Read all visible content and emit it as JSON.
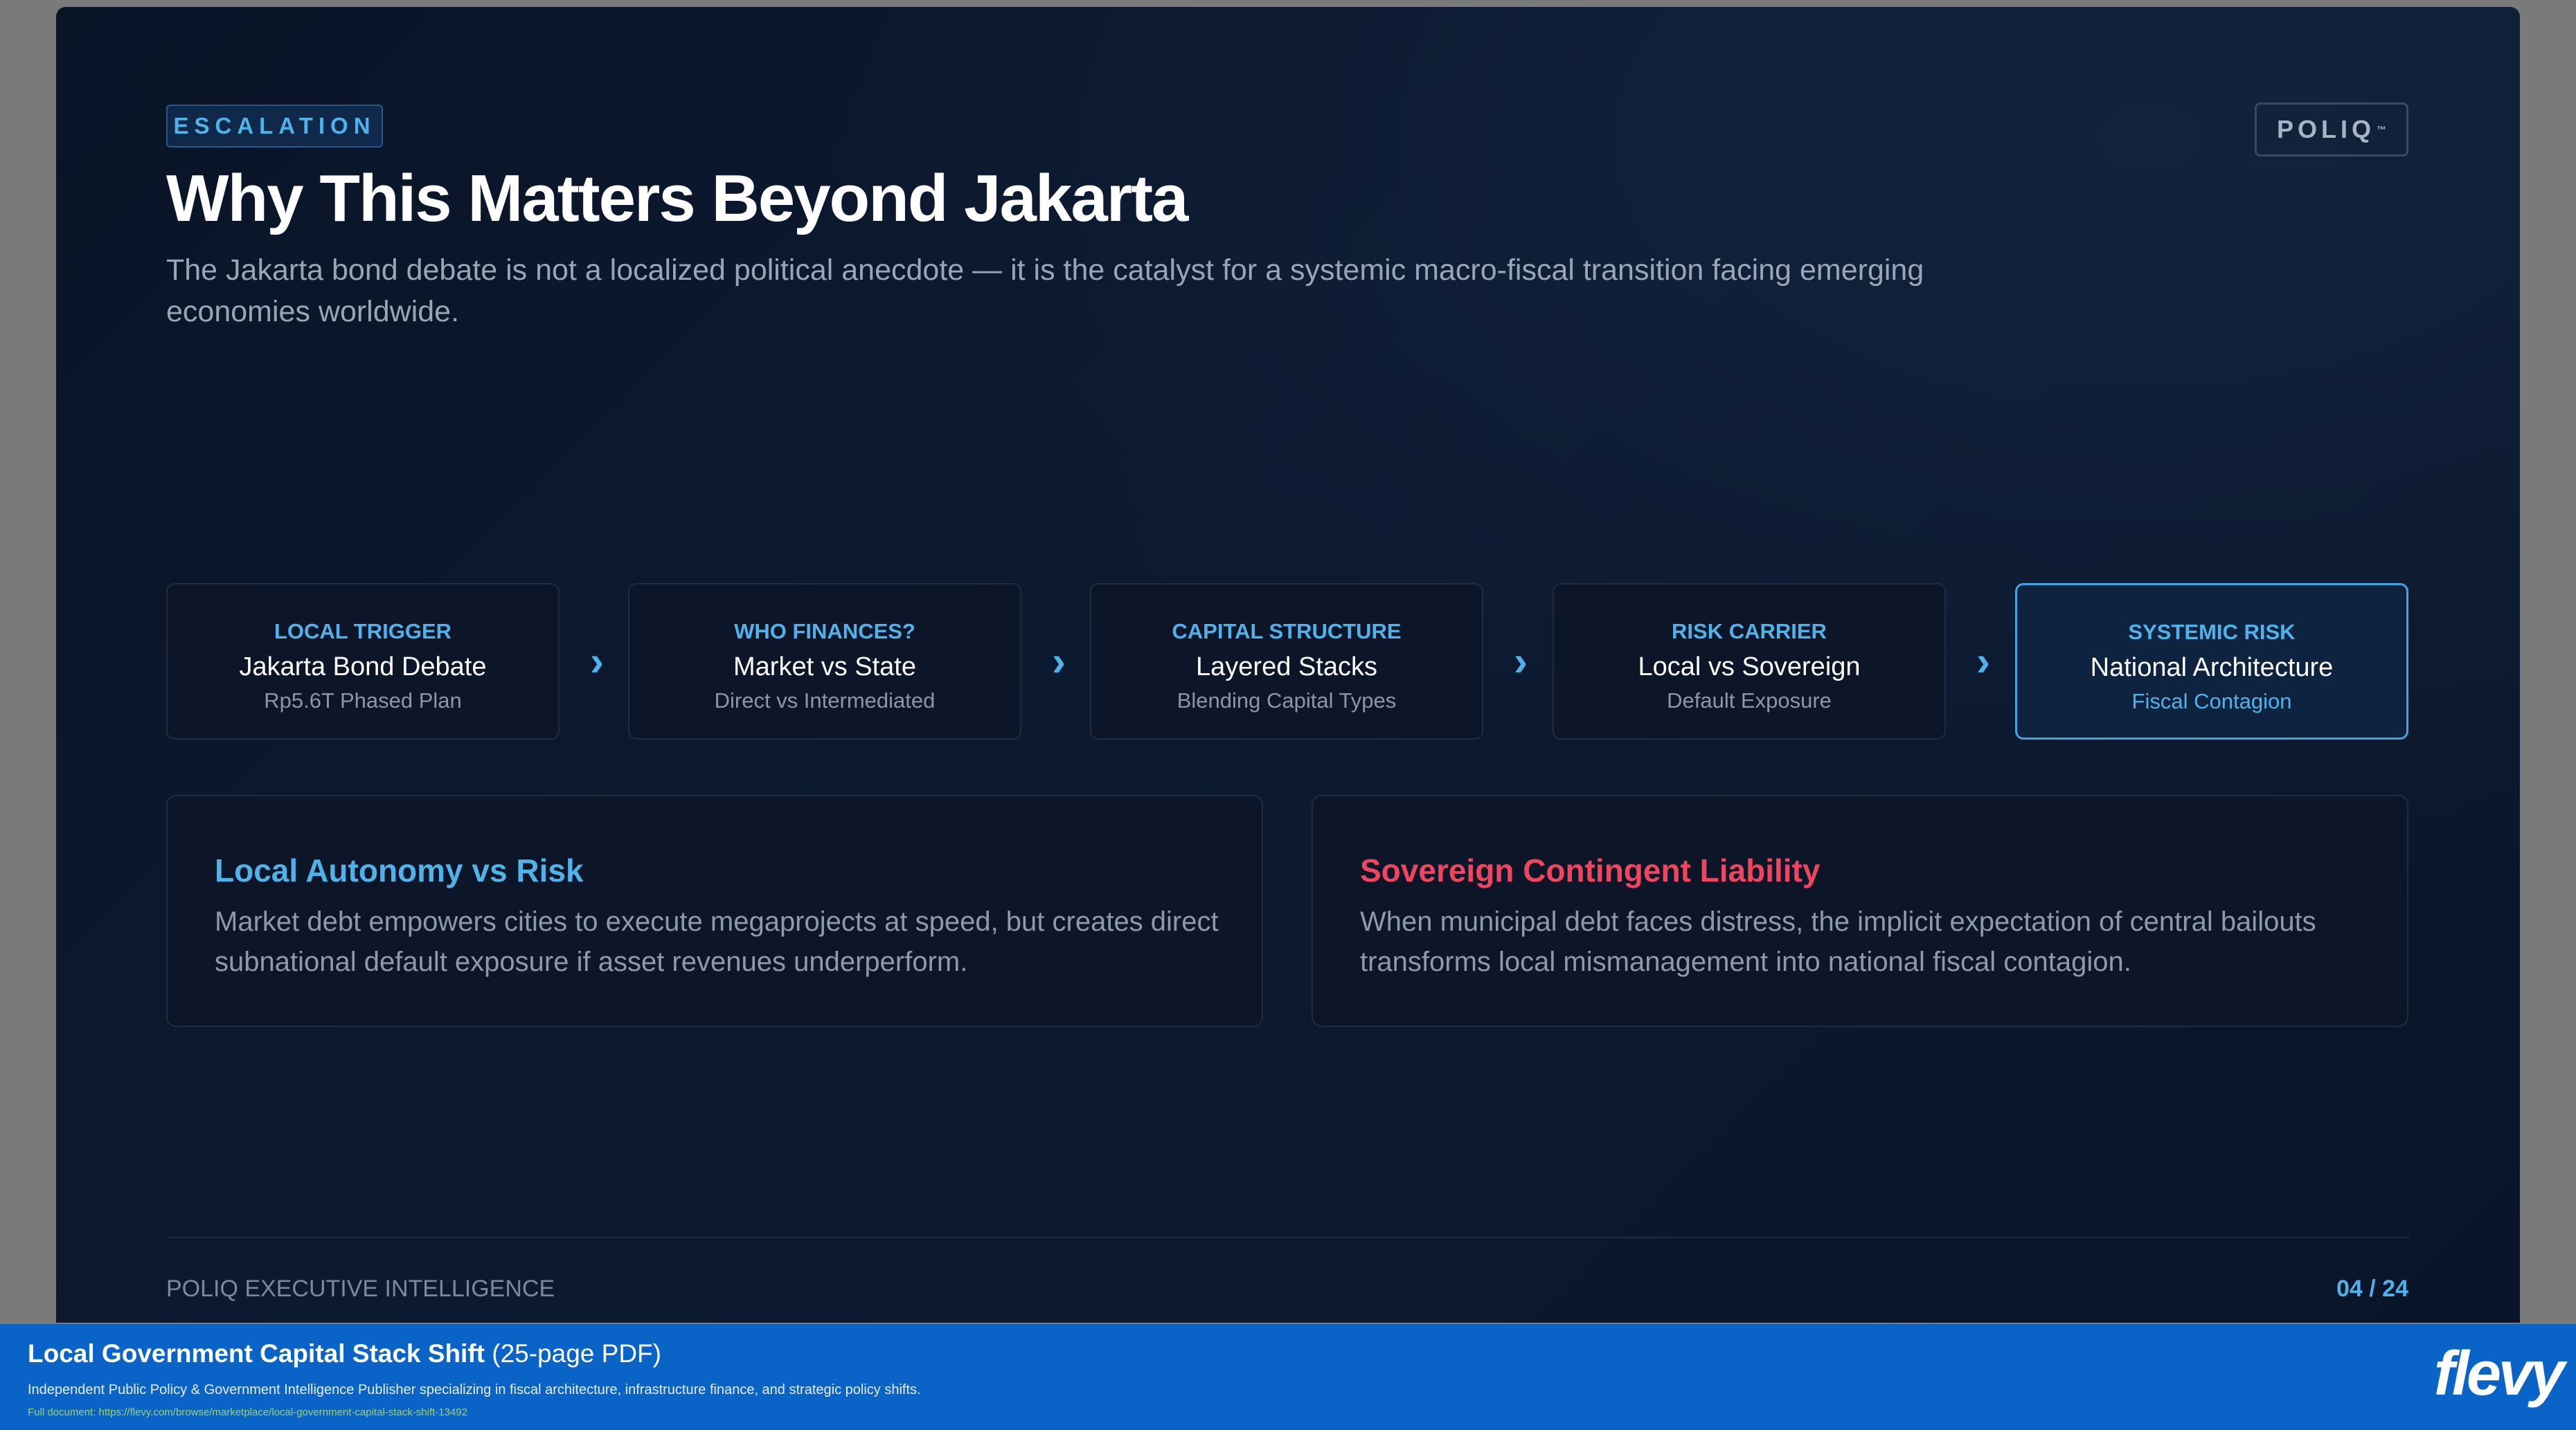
{
  "slide": {
    "tag": "ESCALATION",
    "logo": "POLIQ",
    "logo_tm": "™",
    "title": "Why This Matters Beyond Jakarta",
    "subtitle": "The Jakarta bond debate is not a localized political anecdote — it is the catalyst for a systemic macro-fiscal transition facing emerging economies worldwide.",
    "flow": [
      {
        "label": "LOCAL TRIGGER",
        "name": "Jakarta Bond Debate",
        "sub": "Rp5.6T Phased Plan"
      },
      {
        "label": "WHO FINANCES?",
        "name": "Market vs State",
        "sub": "Direct vs Intermediated"
      },
      {
        "label": "CAPITAL STRUCTURE",
        "name": "Layered Stacks",
        "sub": "Blending Capital Types"
      },
      {
        "label": "RISK CARRIER",
        "name": "Local vs Sovereign",
        "sub": "Default Exposure"
      },
      {
        "label": "SYSTEMIC RISK",
        "name": "National Architecture",
        "sub": "Fiscal Contagion"
      }
    ],
    "cards": [
      {
        "title": "Local Autonomy vs Risk",
        "body": "Market debt empowers cities to execute megaprojects at speed, but creates direct subnational default exposure if asset revenues underperform.",
        "color": "#4fb3ea"
      },
      {
        "title": "Sovereign Contingent Liability",
        "body": "When municipal debt faces distress, the implicit expectation of central bailouts transforms local mismanagement into national fiscal contagion.",
        "color": "#f0455e"
      }
    ],
    "footer_left": "POLIQ EXECUTIVE INTELLIGENCE",
    "page": "04 / 24"
  },
  "banner": {
    "title_bold": "Local Government Capital Stack Shift",
    "title_rest": " (25-page PDF)",
    "description": "Independent Public Policy & Government Intelligence Publisher specializing in fiscal architecture, infrastructure finance, and strategic policy shifts.",
    "url": "Full document: https://flevy.com/browse/marketplace/local-government-capital-stack-shift-13492",
    "logo": "flevy"
  },
  "colors": {
    "accent": "#4fb3ea",
    "alert": "#f0455e",
    "banner": "#0a64c8"
  }
}
